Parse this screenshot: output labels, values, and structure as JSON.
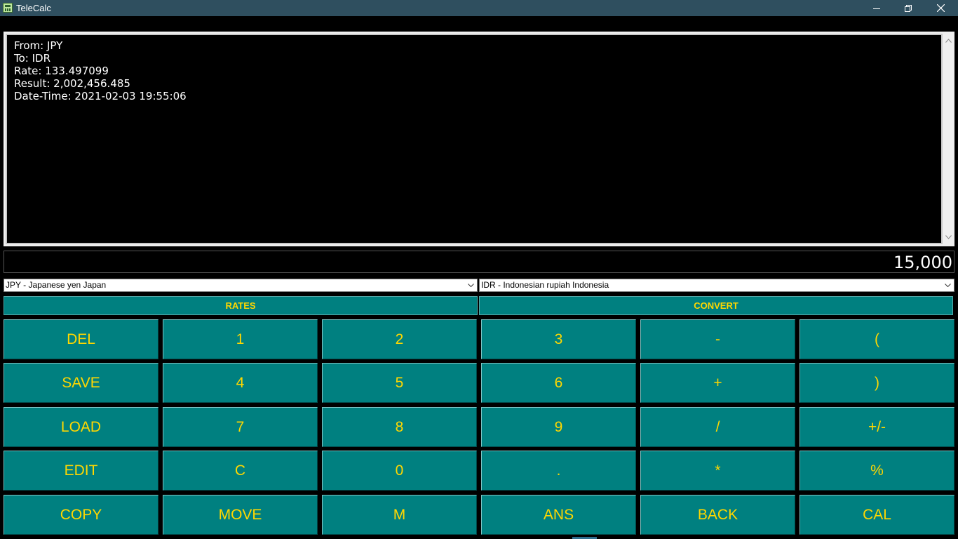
{
  "window": {
    "title": "TeleCalc",
    "icon": "calculator-app-icon"
  },
  "window_controls": [
    "minimize-icon",
    "restore-icon",
    "close-icon"
  ],
  "output": {
    "lines": [
      "From: JPY",
      "To: IDR",
      "Rate: 133.497099",
      "Result: 2,002,456.485",
      "Date-Time: 2021-02-03 19:55:06"
    ]
  },
  "display": {
    "value": "15,000"
  },
  "from_currency": {
    "selected": "JPY - Japanese yen Japan"
  },
  "to_currency": {
    "selected": "IDR - Indonesian rupiah Indonesia"
  },
  "actions": {
    "rates": "RATES",
    "convert": "CONVERT"
  },
  "keys": [
    [
      "DEL",
      "1",
      "2",
      "3",
      "-",
      "("
    ],
    [
      "SAVE",
      "4",
      "5",
      "6",
      "+",
      ")"
    ],
    [
      "LOAD",
      "7",
      "8",
      "9",
      "/",
      "+/-"
    ],
    [
      "EDIT",
      "C",
      "0",
      ".",
      "*",
      "%"
    ],
    [
      "COPY",
      "MOVE",
      "M",
      "ANS",
      "BACK",
      "CAL"
    ]
  ],
  "colors": {
    "button_bg": "#008080",
    "button_text": "#ffd700",
    "titlebar": "#2f4f5f"
  }
}
